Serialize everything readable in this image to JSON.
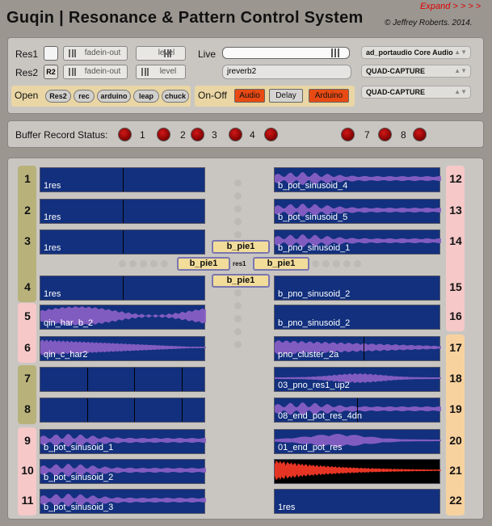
{
  "header": {
    "title": "Guqin | Resonance &  Pattern Control System",
    "copyright": "© Jeffrey Roberts. 2014.",
    "expand_label": "Expand > > > >"
  },
  "controls": {
    "res1_label": "Res1",
    "res2_label": "Res2",
    "r2_label": "R2",
    "res1_fade_label": "fadein-out",
    "res1_level_label": "level",
    "res2_fade_label": "fadein-out",
    "res2_level_label": "level",
    "open_label": "Open",
    "open_buttons": [
      "Res2",
      "rec",
      "arduino",
      "leap",
      "chuck"
    ],
    "live_label": "Live",
    "live_slider_value": 0.93,
    "reverb_value": "jreverb2",
    "onoff_label": "On-Off",
    "onoff_buttons": [
      {
        "label": "Audio",
        "state": "on"
      },
      {
        "label": "Delay",
        "state": "off"
      },
      {
        "label": "Arduino",
        "state": "on"
      }
    ],
    "audio_driver": "ad_portaudio Core Audio",
    "input_device": "QUAD-CAPTURE",
    "output_device": "QUAD-CAPTURE"
  },
  "buffer": {
    "label": "Buffer Record Status:",
    "numbers": [
      "1",
      "2",
      "3",
      "4",
      "7",
      "8"
    ]
  },
  "left_slots": [
    {
      "num": "1",
      "name": "1res"
    },
    {
      "num": "2",
      "name": "1res"
    },
    {
      "num": "3",
      "name": "1res"
    },
    {
      "num": "4",
      "name": "1res"
    },
    {
      "num": "5",
      "name": "qin_har_b_2"
    },
    {
      "num": "6",
      "name": "qin_c_har2"
    },
    {
      "num": "7",
      "name": ""
    },
    {
      "num": "8",
      "name": ""
    },
    {
      "num": "9",
      "name": "b_pot_sinusoid_1"
    },
    {
      "num": "10",
      "name": "b_pot_sinusoid_2"
    },
    {
      "num": "11",
      "name": "b_pot_sinusoid_3"
    }
  ],
  "right_slots": [
    {
      "num": "12",
      "name": "b_pot_sinusoid_4"
    },
    {
      "num": "13",
      "name": "b_pot_sinusoid_5"
    },
    {
      "num": "14",
      "name": "b_pno_sinusoid_1"
    },
    {
      "num": "15",
      "name": "b_pno_sinusoid_2"
    },
    {
      "num": "16",
      "name": "b_pno_sinusoid_2"
    },
    {
      "num": "17",
      "name": "pno_cluster_2a"
    },
    {
      "num": "18",
      "name": "03_pno_res1_up2"
    },
    {
      "num": "19",
      "name": "08_end_pot_res_4dn"
    },
    {
      "num": "20",
      "name": "01_end_pot_res"
    },
    {
      "num": "21",
      "name": ""
    },
    {
      "num": "22",
      "name": "1res"
    }
  ],
  "mixer": {
    "top": "b_pie1",
    "left": "b_pie1",
    "center": "res1",
    "right": "b_pie1",
    "bottom": "b_pie1"
  },
  "colors": {
    "background": "#9b9690",
    "panel": "#c9c6c2",
    "waveform_bg": "#12307e",
    "waveform_purple": "#8e62c8",
    "waveform_red": "#ff3a28",
    "led_red": "#b00000",
    "accent_orange": "#e84a14",
    "group_olive": "#b8b27a",
    "group_pink": "#f6c8c8",
    "group_peach": "#f8d29e",
    "mixer_button": "#f2dc9a"
  }
}
